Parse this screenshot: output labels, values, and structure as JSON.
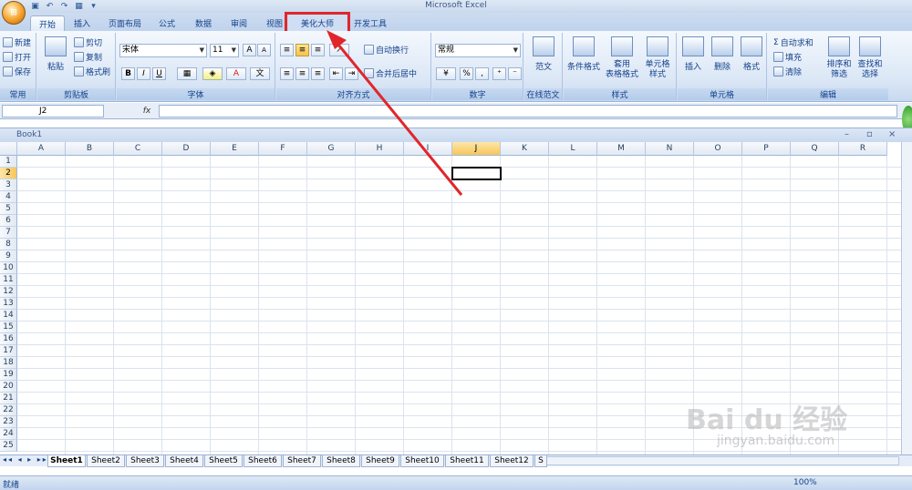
{
  "app": {
    "title": "Microsoft Excel"
  },
  "office_button": {
    "label": "⊞"
  },
  "tabs": [
    {
      "label": "开始"
    },
    {
      "label": "插入"
    },
    {
      "label": "页面布局"
    },
    {
      "label": "公式"
    },
    {
      "label": "数据"
    },
    {
      "label": "审阅"
    },
    {
      "label": "视图"
    },
    {
      "label": "美化大师"
    },
    {
      "label": "开发工具"
    }
  ],
  "ribbon": {
    "common": {
      "new": "新建",
      "open": "打开",
      "save": "保存",
      "label": "常用"
    },
    "clipboard": {
      "paste": "粘贴",
      "cut": "剪切",
      "copy": "复制",
      "format_painter": "格式刷",
      "label": "剪贴板"
    },
    "font": {
      "name": "宋体",
      "size": "11",
      "bold": "B",
      "italic": "I",
      "underline": "U",
      "grow": "A",
      "shrink": "A",
      "color_a": "A",
      "label": "字体"
    },
    "alignment": {
      "wrap": "自动换行",
      "merge": "合并后居中",
      "label": "对齐方式"
    },
    "number": {
      "format": "常规",
      "percent": "%",
      "comma": ",",
      "label": "数字"
    },
    "template": {
      "item": "范文",
      "label": "在线范文"
    },
    "styles": {
      "cond": "条件格式",
      "table": "套用\n表格格式",
      "cell": "单元格\n样式",
      "label": "样式"
    },
    "cells": {
      "insert": "插入",
      "delete": "删除",
      "format": "格式",
      "label": "单元格"
    },
    "editing": {
      "autosum": "自动求和",
      "fill": "填充",
      "clear": "清除",
      "sort": "排序和\n筛选",
      "find": "查找和\n选择",
      "label": "编辑"
    }
  },
  "formula": {
    "namebox": "J2",
    "fx": "fx",
    "value": ""
  },
  "workbook": {
    "title": "Book1"
  },
  "columns": [
    "A",
    "B",
    "C",
    "D",
    "E",
    "F",
    "G",
    "H",
    "I",
    "J",
    "K",
    "L",
    "M",
    "N",
    "O",
    "P",
    "Q",
    "R"
  ],
  "rows": [
    "1",
    "2",
    "3",
    "4",
    "5",
    "6",
    "7",
    "8",
    "9",
    "10",
    "11",
    "12",
    "13",
    "14",
    "15",
    "16",
    "17",
    "18",
    "19",
    "20",
    "21",
    "22",
    "23",
    "24",
    "25"
  ],
  "sheets": [
    "Sheet1",
    "Sheet2",
    "Sheet3",
    "Sheet4",
    "Sheet5",
    "Sheet6",
    "Sheet7",
    "Sheet8",
    "Sheet9",
    "Sheet10",
    "Sheet11",
    "Sheet12",
    "S"
  ],
  "status": {
    "ready": "就绪",
    "zoom": "100%"
  },
  "watermark": {
    "brand": "Bai du 经验",
    "url": "jingyan.baidu.com"
  },
  "colors": {
    "highlight": "#e0262b",
    "selected_header": "#f6c65a"
  }
}
